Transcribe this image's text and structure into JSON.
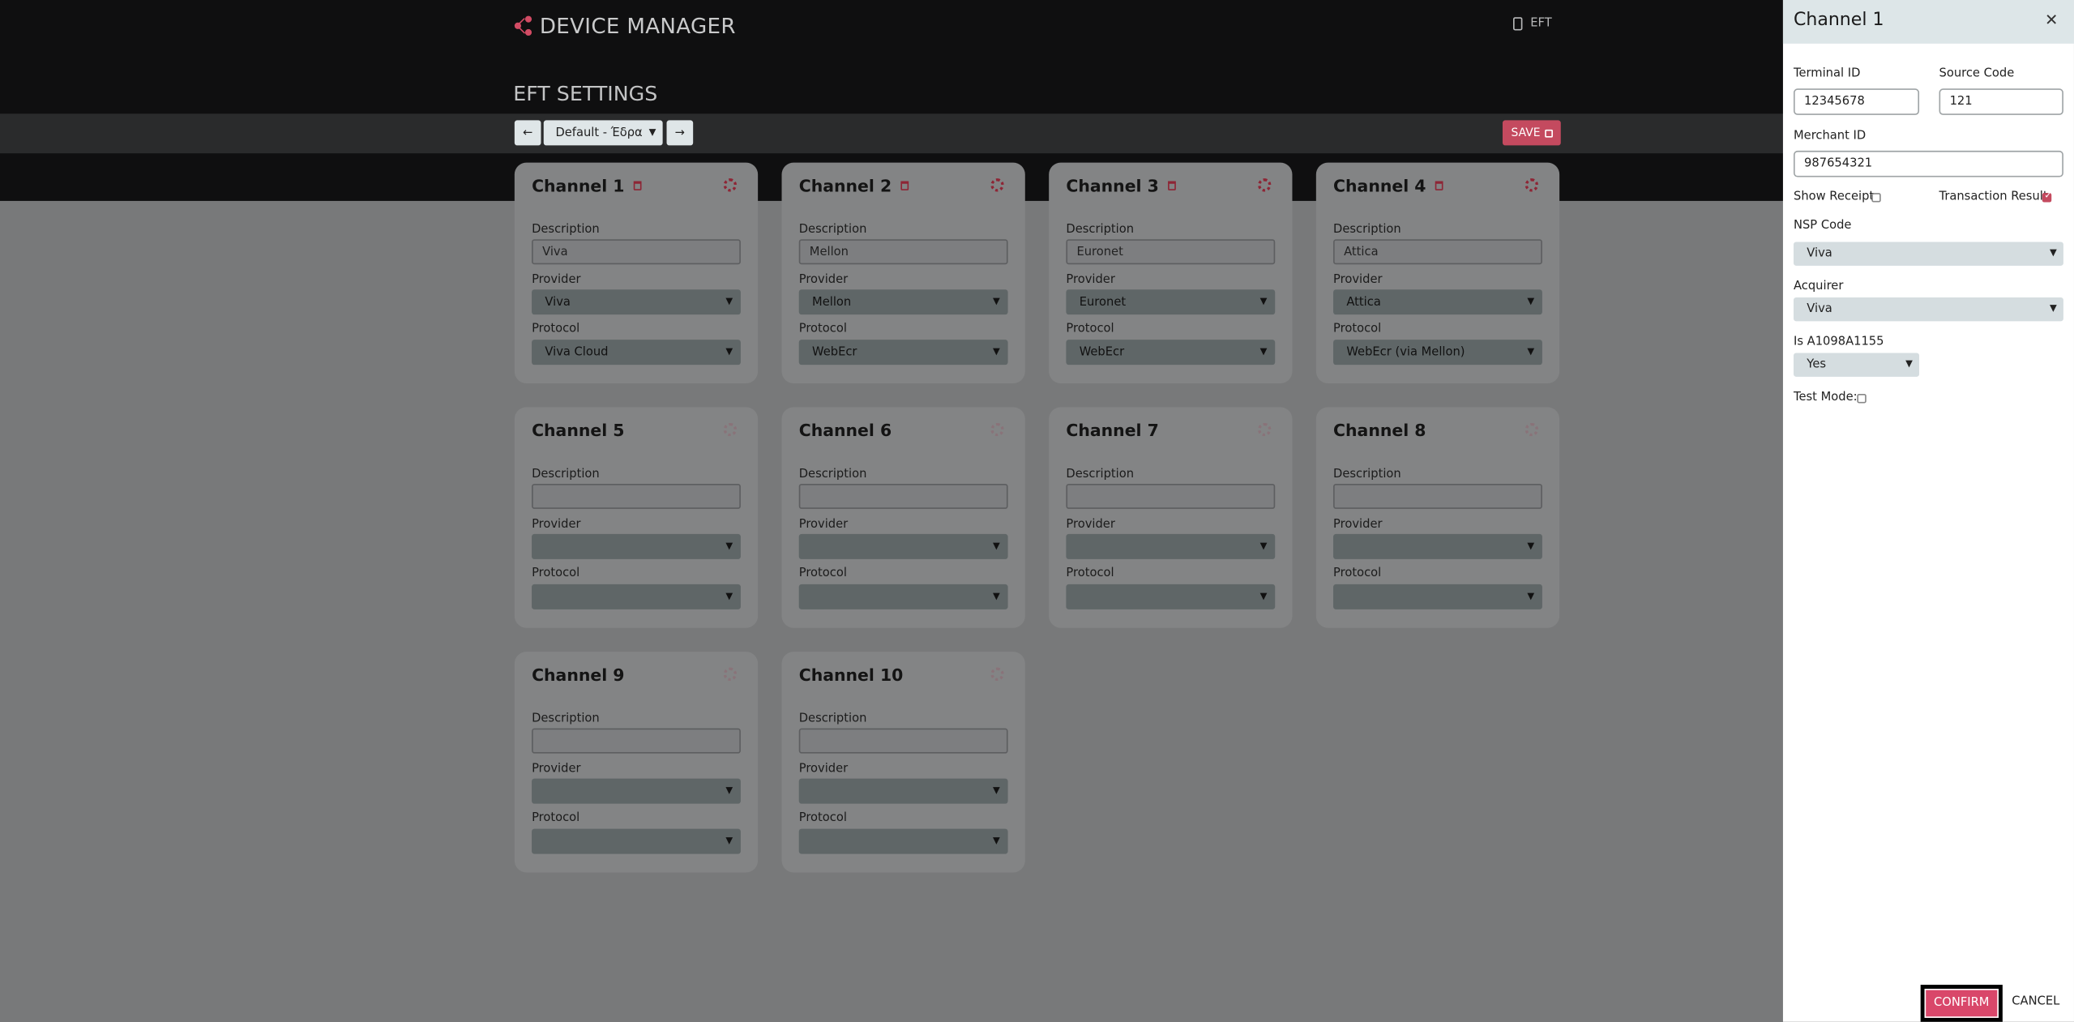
{
  "header": {
    "app_title": "DEVICE MANAGER",
    "eft_link": "EFT",
    "page_title": "EFT SETTINGS"
  },
  "toolbar": {
    "prev_icon": "arrow-left-icon",
    "next_icon": "arrow-right-icon",
    "profile_value": "Default - Έδρα",
    "save_label": "SAVE"
  },
  "channels": [
    {
      "title": "Channel 1",
      "description": "Viva",
      "provider": "Viva",
      "protocol": "Viva Cloud"
    },
    {
      "title": "Channel 2",
      "description": "Mellon",
      "provider": "Mellon",
      "protocol": "WebEcr"
    },
    {
      "title": "Channel 3",
      "description": "Euronet",
      "provider": "Euronet",
      "protocol": "WebEcr"
    },
    {
      "title": "Channel 4",
      "description": "Attica",
      "provider": "Attica",
      "protocol": "WebEcr (via Mellon)"
    },
    {
      "title": "Channel 5",
      "description": "",
      "provider": "",
      "protocol": ""
    },
    {
      "title": "Channel 6",
      "description": "",
      "provider": "",
      "protocol": ""
    },
    {
      "title": "Channel 7",
      "description": "",
      "provider": "",
      "protocol": ""
    },
    {
      "title": "Channel 8",
      "description": "",
      "provider": "",
      "protocol": ""
    },
    {
      "title": "Channel 9",
      "description": "",
      "provider": "",
      "protocol": ""
    },
    {
      "title": "Channel 10",
      "description": "",
      "provider": "",
      "protocol": ""
    }
  ],
  "field_labels": {
    "description": "Description",
    "provider": "Provider",
    "protocol": "Protocol"
  },
  "panel": {
    "title": "Channel 1",
    "terminal_id_label": "Terminal ID",
    "terminal_id": "12345678",
    "source_code_label": "Source Code",
    "source_code": "121",
    "merchant_id_label": "Merchant ID",
    "merchant_id": "987654321",
    "show_receipt_label": "Show Receipt:",
    "show_receipt": false,
    "transaction_result_label": "Transaction Result:",
    "transaction_result": true,
    "nsp_code_label": "NSP Code",
    "nsp_code": "Viva",
    "acquirer_label": "Acquirer",
    "acquirer": "Viva",
    "is_a1098_label": "Is A1098A1155",
    "is_a1098": "Yes",
    "test_mode_label": "Test Mode:",
    "test_mode": false,
    "confirm_label": "CONFIRM",
    "cancel_label": "CANCEL"
  },
  "colors": {
    "accent": "#c44a5f",
    "header_bg": "#0f0f10",
    "overlay_bg": "#78797a",
    "panel_header_bg": "#dde6e8"
  }
}
